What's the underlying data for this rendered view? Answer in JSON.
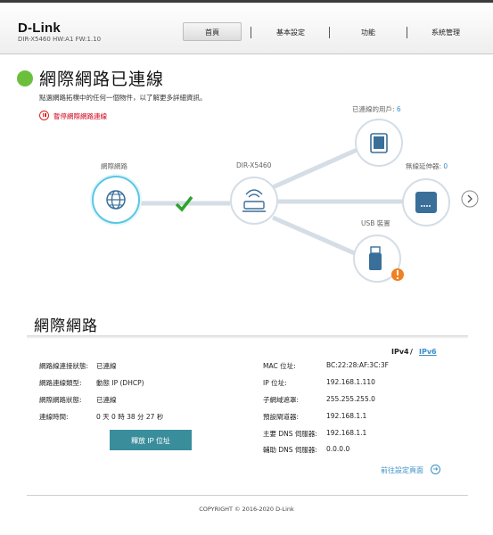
{
  "header": {
    "brand": "D-Link",
    "model_line": "DIR-X5460 HW:A1 FW:1.10",
    "nav": [
      "首頁",
      "基本設定",
      "功能",
      "系統管理"
    ]
  },
  "status": {
    "title": "網際網路已連線",
    "description": "點選網路拓樸中的任何一個物件，以了解更多詳細資訊。",
    "pause_link": "暫停網際網路連線",
    "indicator_color": "#6cbf3c"
  },
  "topology": {
    "internet_label": "網際網路",
    "router_label": "DIR-X5460",
    "clients_label": "已連線的用戶:",
    "clients_count": "6",
    "extender_label": "無線延伸器:",
    "extender_count": "0",
    "usb_label": "USB 裝置",
    "icons": [
      "globe-icon",
      "router-icon",
      "tablet-icon",
      "extender-icon",
      "usb-drive-icon",
      "checkmark-icon",
      "warning-icon",
      "chevron-right-icon"
    ]
  },
  "internet": {
    "section_title": "網際網路",
    "ipv4": "IPv4",
    "sep": "/",
    "ipv6": "IPv6",
    "left": [
      {
        "label": "網路線連接狀態:",
        "value": "已連線"
      },
      {
        "label": "網路連線類型:",
        "value": "動態 IP (DHCP)"
      },
      {
        "label": "網際網路狀態:",
        "value": "已連線"
      },
      {
        "label": "連線時間:",
        "value": "0 天 0 時 38 分 27 秒"
      }
    ],
    "right": [
      {
        "label": "MAC 位址:",
        "value": "BC:22:28:AF:3C:3F"
      },
      {
        "label": "IP 位址:",
        "value": "192.168.1.110"
      },
      {
        "label": "子網域遮罩:",
        "value": "255.255.255.0"
      },
      {
        "label": "預設閘道器:",
        "value": "192.168.1.1"
      },
      {
        "label": "主要 DNS 伺服器:",
        "value": "192.168.1.1"
      },
      {
        "label": "輔助 DNS 伺服器:",
        "value": "0.0.0.0"
      }
    ],
    "release_button": "釋放 IP 位址",
    "goto_link": "前往設定頁面"
  },
  "footer": {
    "copyright": "COPYRIGHT © 2016-2020 D-Link"
  }
}
